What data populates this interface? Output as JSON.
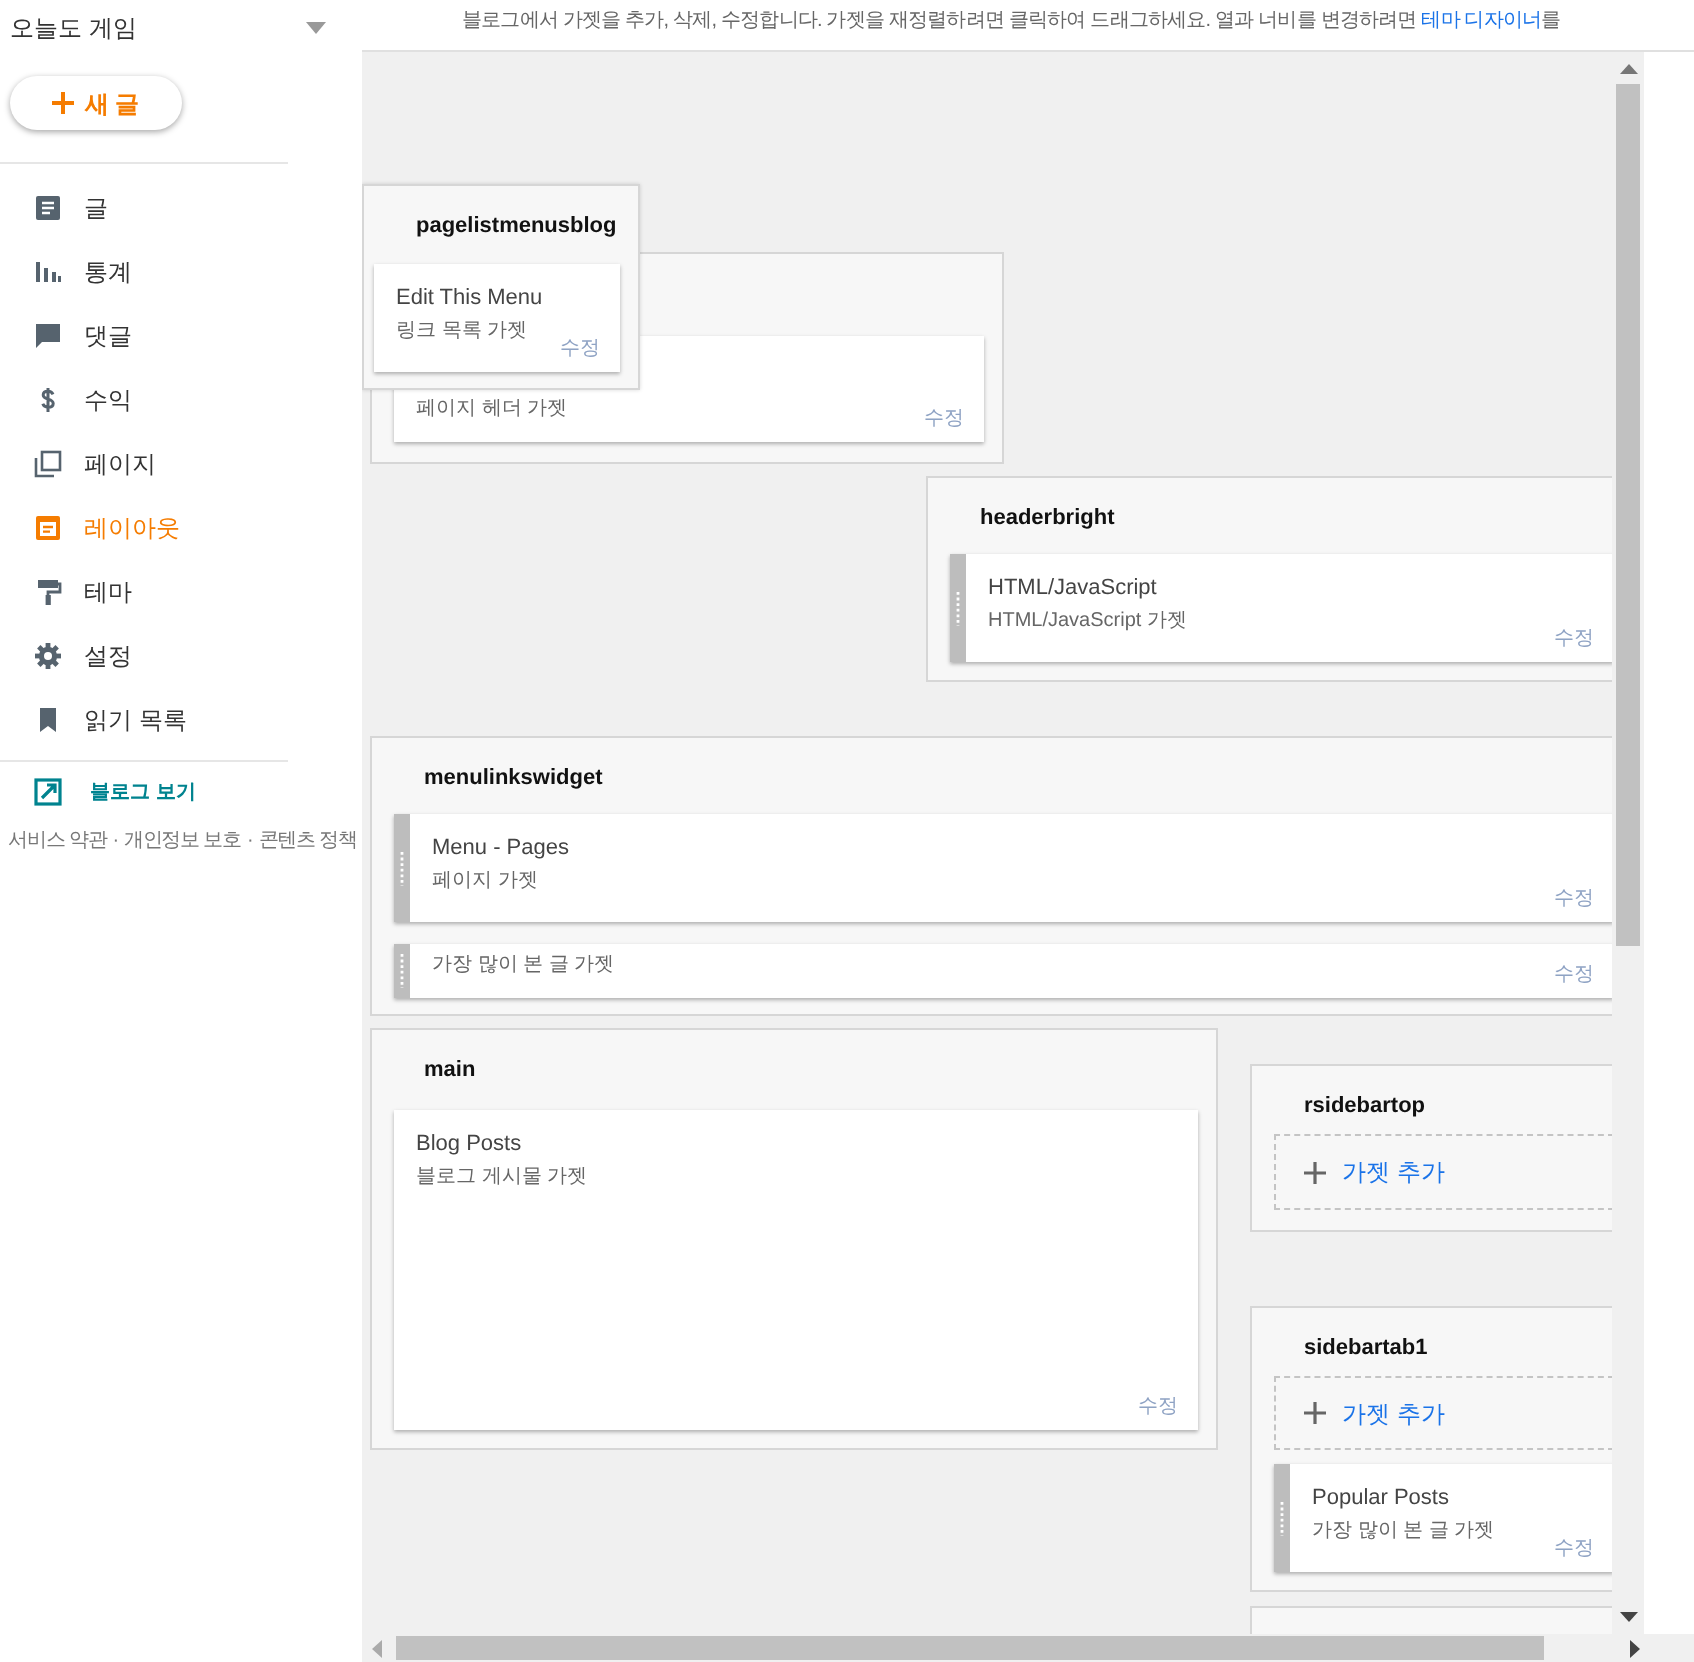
{
  "blog": {
    "title": "오늘도 게임"
  },
  "new_post_button": {
    "label": "새 글"
  },
  "nav": [
    {
      "label": "글",
      "selected": false
    },
    {
      "label": "통계",
      "selected": false
    },
    {
      "label": "댓글",
      "selected": false
    },
    {
      "label": "수익",
      "selected": false
    },
    {
      "label": "페이지",
      "selected": false
    },
    {
      "label": "레이아웃",
      "selected": true
    },
    {
      "label": "테마",
      "selected": false
    },
    {
      "label": "설정",
      "selected": false
    },
    {
      "label": "읽기 목록",
      "selected": false
    }
  ],
  "view_blog": {
    "label": "블로그 보기"
  },
  "footer": {
    "links": [
      "서비스 약관",
      "개인정보 보호",
      "콘텐츠 정책"
    ],
    "separator": "·"
  },
  "intro": {
    "text": "블로그에서 가젯을 추가, 삭제, 수정합니다. 가젯을 재정렬하려면 클릭하여 드래그하세요. 열과 너비를 변경하려면 ",
    "link": "테마 디자이너",
    "after": "를"
  },
  "sections": [
    {
      "kind": "dragged",
      "title": "pagelistmenusblog",
      "widgets": [
        {
          "title": "Edit This Menu",
          "subtitle": "링크 목록 가젯",
          "edit": "수정",
          "handle": false
        }
      ]
    },
    {
      "kind": "panel",
      "widgets": [
        {
          "subtitle": "페이지 헤더 가젯",
          "edit": "수정",
          "handle": false
        }
      ]
    },
    {
      "kind": "panel",
      "title": "headerbright",
      "widgets": [
        {
          "title": "HTML/JavaScript",
          "subtitle": "HTML/JavaScript 가젯",
          "edit": "수정",
          "handle": true
        }
      ]
    },
    {
      "kind": "panel",
      "title": "menulinkswidget",
      "widgets": [
        {
          "title": "Menu - Pages",
          "subtitle": "페이지 가젯",
          "edit": "수정",
          "handle": true
        },
        {
          "subtitle": "가장 많이 본 글 가젯",
          "edit": "수정",
          "handle": true
        }
      ]
    },
    {
      "kind": "panel",
      "title": "main",
      "widgets": [
        {
          "title": "Blog Posts",
          "subtitle": "블로그 게시물 가젯",
          "edit": "수정",
          "handle": false
        }
      ]
    },
    {
      "kind": "panel",
      "title": "rsidebartop",
      "add_gadget": "가젯 추가"
    },
    {
      "kind": "panel",
      "title": "sidebartab1",
      "add_gadget": "가젯 추가",
      "widgets": [
        {
          "title": "Popular Posts",
          "subtitle": "가장 많이 본 글 가젯",
          "edit": "수정",
          "handle": true
        }
      ]
    },
    {
      "kind": "panel"
    }
  ]
}
